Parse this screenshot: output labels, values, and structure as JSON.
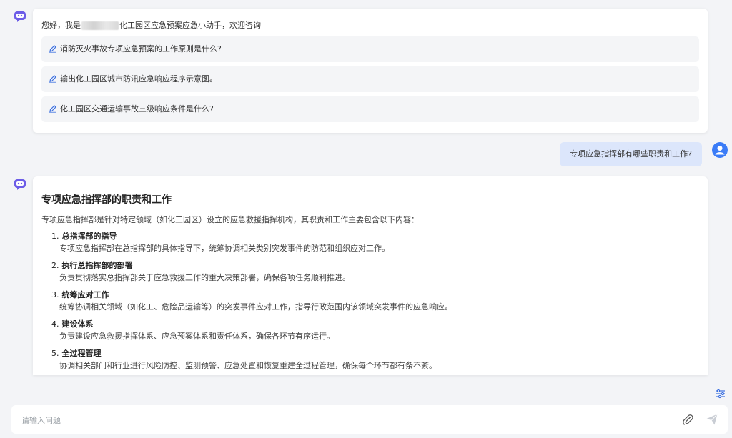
{
  "colors": {
    "accent": "#6c5ce7",
    "user_bubble": "#dce6fb",
    "user_avatar": "#3b7cf7",
    "background": "#f3f4f7"
  },
  "welcome": {
    "greeting_prefix": "您好，我是",
    "greeting_suffix": "化工园区应急预案应急小助手，欢迎咨询",
    "suggestions": [
      "消防灭火事故专项应急预案的工作原则是什么?",
      "输出化工园区城市防汛应急响应程序示意图。",
      "化工园区交通运输事故三级响应条件是什么?"
    ]
  },
  "user_message": "专项应急指挥部有哪些职责和工作?",
  "answer": {
    "title": "专项应急指挥部的职责和工作",
    "intro": "专项应急指挥部是针对特定领域（如化工园区）设立的应急救援指挥机构，其职责和工作主要包含以下内容：",
    "items": [
      {
        "num": "1.",
        "head": "总指挥部的指导",
        "body": "专项应急指挥部在总指挥部的具体指导下，统筹协调相关类别突发事件的防范和组织应对工作。"
      },
      {
        "num": "2.",
        "head": "执行总指挥部的部署",
        "body": "负责贯彻落实总指挥部关于应急救援工作的重大决策部署，确保各项任务顺利推进。"
      },
      {
        "num": "3.",
        "head": "统筹应对工作",
        "body": "统筹协调相关领域（如化工、危险品运输等）的突发事件应对工作，指导行政范围内该领域突发事件的应急响应。"
      },
      {
        "num": "4.",
        "head": "建设体系",
        "body": "负责建设应急救援指挥体系、应急预案体系和责任体系，确保各环节有序运行。"
      },
      {
        "num": "5.",
        "head": "全过程管理",
        "body": "协调相关部门和行业进行风险防控、监测预警、应急处置和恢复重建全过程管理，确保每个环节都有条不紊。"
      }
    ]
  },
  "input": {
    "placeholder": "请输入问题"
  },
  "icons": {
    "bot": "chat-bot-icon",
    "user": "user-avatar-icon",
    "pencil": "pencil-icon",
    "settings": "settings-sliders-icon",
    "attach": "paperclip-icon",
    "send": "send-icon"
  }
}
